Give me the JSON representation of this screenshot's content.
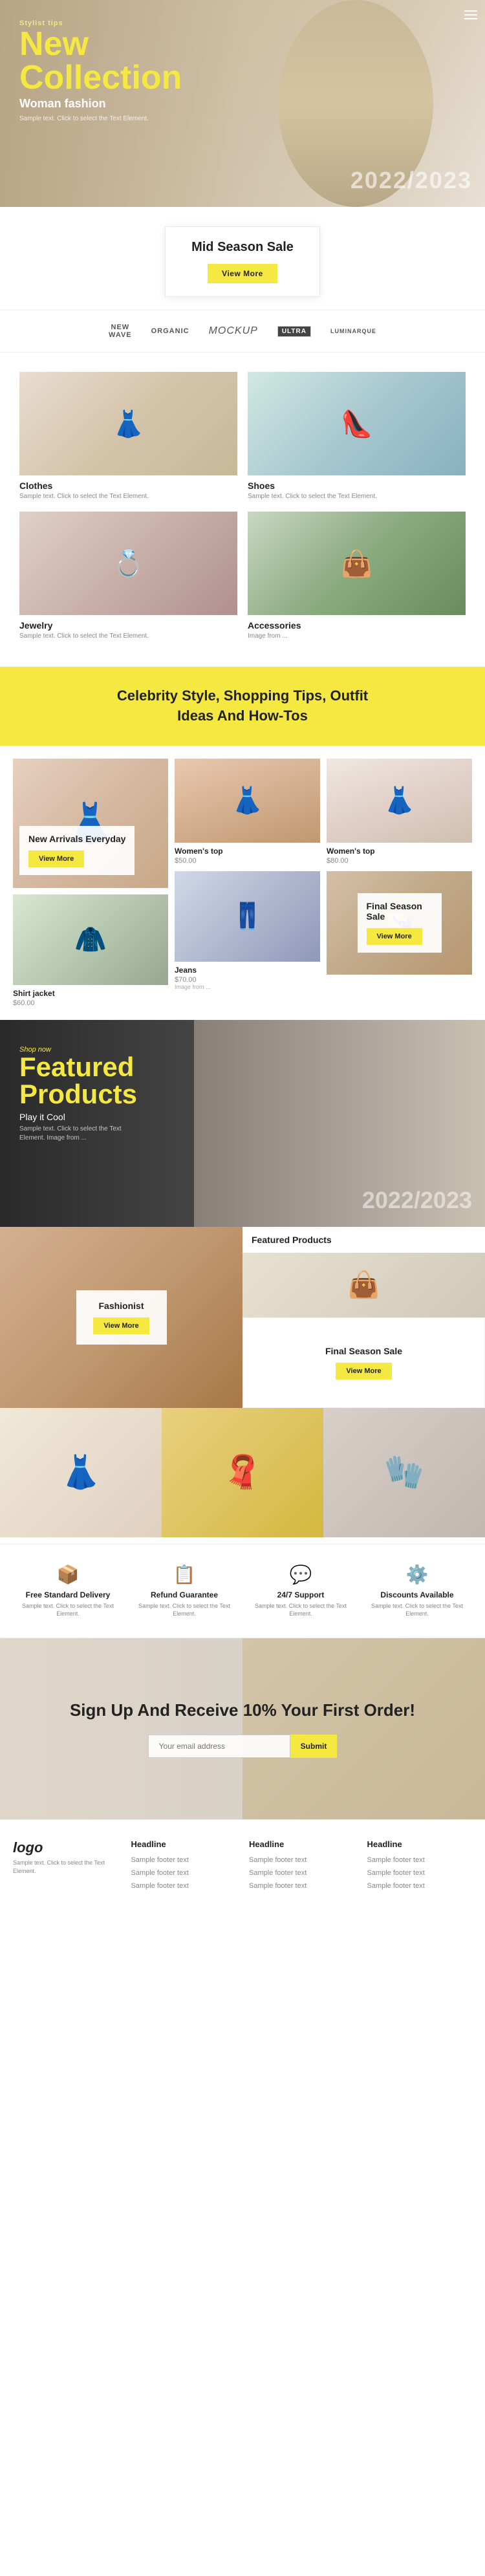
{
  "hero": {
    "tag": "Stylist tips",
    "title_new": "New",
    "title_collection": "Collection",
    "subtitle": "Woman fashion",
    "desc": "Sample text. Click to select the Text Element.",
    "year": "2022/2023",
    "nav_icon": "≡"
  },
  "mid_sale": {
    "title": "Mid Season Sale",
    "btn": "View More"
  },
  "brands": [
    {
      "name": "NEW WAVE",
      "style": "stacked"
    },
    {
      "name": "ORGANIC",
      "style": "normal"
    },
    {
      "name": "Mockup",
      "style": "cursive"
    },
    {
      "name": "Ultra",
      "style": "box"
    },
    {
      "name": "LUMINARQUE",
      "style": "normal"
    }
  ],
  "categories": [
    {
      "name": "Clothes",
      "desc": "Sample text. Click to select the Text Element.",
      "icon": "👗"
    },
    {
      "name": "Shoes",
      "desc": "Sample text. Click to select the Text Element.",
      "icon": "👠"
    },
    {
      "name": "Jewelry",
      "desc": "Sample text. Click to select the Text Element.",
      "icon": "💍"
    },
    {
      "name": "Accessories",
      "desc": "Image from ...",
      "icon": "👜"
    }
  ],
  "yellow_banner": {
    "text": "Celebrity Style, Shopping Tips, Outfit Ideas And How-Tos"
  },
  "new_arrivals": {
    "title": "New Arrivals Everyday",
    "btn": "View More"
  },
  "products": {
    "women_top_1": {
      "name": "Women's top",
      "price": "$50.00",
      "icon": "👗"
    },
    "women_top_2": {
      "name": "Women's top",
      "price": "$80.00",
      "icon": "👗"
    },
    "jeans": {
      "name": "Jeans",
      "price": "$70.00",
      "from": "Image from ...",
      "icon": "👖"
    },
    "shirt_jacket": {
      "name": "Shirt jacket",
      "price": "$60.00",
      "icon": "🧥"
    }
  },
  "final_season_sale_1": {
    "title": "Final Season Sale",
    "btn": "View More"
  },
  "featured": {
    "tag": "Shop now",
    "title_1": "Featured",
    "title_2": "Products",
    "subtitle": "Play it Cool",
    "desc": "Sample text. Click to select the Text Element. Image from ...",
    "year": "2022/2023"
  },
  "fashionist": {
    "title": "Fashionist",
    "btn": "View More"
  },
  "featured_products_card": {
    "title": "Featured Products"
  },
  "final_season_sale_2": {
    "title": "Final Season Sale",
    "btn": "View More"
  },
  "services": [
    {
      "icon": "📦",
      "title": "Free Standard Delivery",
      "desc": "Sample text. Click to select the Text Element."
    },
    {
      "icon": "📋",
      "title": "Refund Guarantee",
      "desc": "Sample text. Click to select the Text Element."
    },
    {
      "icon": "💬",
      "title": "24/7 Support",
      "desc": "Sample text. Click to select the Text Element."
    },
    {
      "icon": "⚙️",
      "title": "Discounts Available",
      "desc": "Sample text. Click to select the Text Element."
    }
  ],
  "newsletter": {
    "title": "Sign Up And Receive 10% Your First Order!",
    "input_placeholder": "Your email address",
    "btn": "Submit"
  },
  "footer": {
    "logo": "logo",
    "logo_desc": "Sample text. Click to select the Text Element.",
    "columns": [
      {
        "title": "Headline",
        "links": [
          "Sample footer text",
          "Sample footer text",
          "Sample footer text"
        ]
      },
      {
        "title": "Headline",
        "links": [
          "Sample footer text",
          "Sample footer text",
          "Sample footer text"
        ]
      },
      {
        "title": "Headline",
        "links": [
          "Sample footer text",
          "Sample footer text",
          "Sample footer text"
        ]
      }
    ]
  }
}
